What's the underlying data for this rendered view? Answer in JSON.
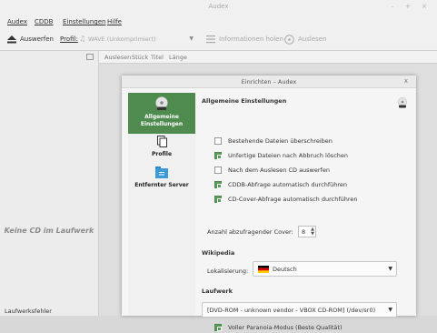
{
  "app": {
    "title": "Audex",
    "controls": "– + ×"
  },
  "menubar": {
    "file": "Audex",
    "cddb": "CDDB",
    "settings": "Einstellungen",
    "help": "Hilfe"
  },
  "toolbar": {
    "eject_label": "Auswerfen",
    "profile_label": "Profil:",
    "profile_value": "WAVE (Unkomprimiert)",
    "fetch_info_label": "Informationen holen",
    "rip_label": "Auslesen"
  },
  "tracks_header": {
    "rip": "Auslesen",
    "track": "Stück",
    "title": "Titel",
    "length": "Länge"
  },
  "left_pane": {
    "no_cd": "Keine CD im Laufwerk"
  },
  "statusbar": {
    "text": "Laufwerksfehler"
  },
  "dialog": {
    "title": "Einrichten – Audex",
    "close": "x",
    "sidebar": [
      {
        "label_line1": "Allgemeine",
        "label_line2": "Einstellungen",
        "icon": "general-settings-icon"
      },
      {
        "label_line1": "Profile",
        "icon": "profiles-icon"
      },
      {
        "label_line1": "Entfernter Server",
        "icon": "folder-icon"
      }
    ],
    "page_title": "Allgemeine Einstellungen",
    "options": [
      {
        "label": "Bestehende Dateien überschreiben",
        "checked": false
      },
      {
        "label": "Unfertige Dateien nach Abbruch löschen",
        "checked": true
      },
      {
        "label": "Nach dem Auslesen CD auswerfen",
        "checked": false
      },
      {
        "label": "CDDB-Abfrage automatisch durchführen",
        "checked": true
      },
      {
        "label": "CD-Cover-Abfrage automatisch durchführen",
        "checked": true
      }
    ],
    "cover_count_label": "Anzahl abzufragender Cover:",
    "cover_count_value": "8",
    "wikipedia_section": "Wikipedia",
    "locale_label": "Lokalisierung:",
    "locale_value": "Deutsch",
    "drive_section": "Laufwerk",
    "drive_value": "[DVD-ROM - unknown vendor - VBOX CD-ROM] (/dev/sr0)",
    "paranoia": {
      "label": "Voller Paranoia-Modus (Beste Qualität)",
      "checked": true
    }
  },
  "colors": {
    "accent": "#4f8b4e",
    "background": "#d8d8d8"
  }
}
